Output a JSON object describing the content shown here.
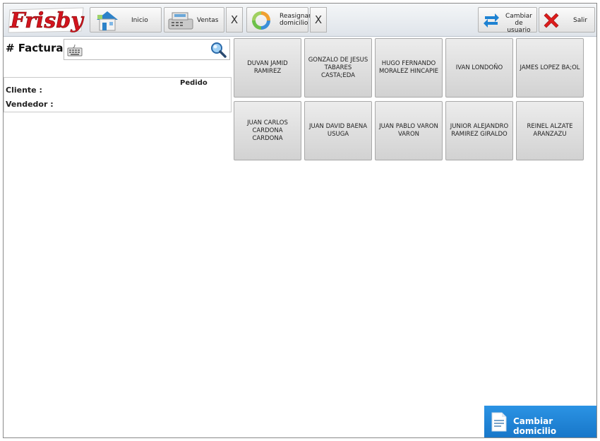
{
  "toolbar": {
    "logo_text": "Frisby",
    "inicio": "Inicio",
    "ventas": "Ventas",
    "close_x": "X",
    "reasignar_line1": "Reasignar",
    "reasignar_line2": "domicilio",
    "cambiar_usuario_line1": "Cambiar de",
    "cambiar_usuario_line2": "usuario",
    "salir": "Salir"
  },
  "factura": {
    "label": "# Factura",
    "value": ""
  },
  "info": {
    "pedido_label": "Pedido",
    "cliente_label": "Cliente :",
    "vendedor_label": "Vendedor :"
  },
  "vendors": [
    {
      "line1": "DUVAN JAMID",
      "line2": "RAMIREZ"
    },
    {
      "line1": "GONZALO DE JESUS",
      "line2": "TABARES CASTA;EDA"
    },
    {
      "line1": "HUGO FERNANDO",
      "line2": "MORALEZ HINCAPIE"
    },
    {
      "line1": "IVAN LONDOÑO",
      "line2": ""
    },
    {
      "line1": "JAMES  LOPEZ BA;OL",
      "line2": ""
    },
    {
      "line1": "JUAN CARLOS",
      "line2": "CARDONA CARDONA"
    },
    {
      "line1": "JUAN DAVID  BAENA",
      "line2": "USUGA"
    },
    {
      "line1": "JUAN PABLO VARON",
      "line2": "VARON"
    },
    {
      "line1": "JUNIOR ALEJANDRO",
      "line2": "RAMIREZ GIRALDO"
    },
    {
      "line1": "REINEL ALZATE",
      "line2": "ARANZAZU"
    }
  ],
  "footer": {
    "cambiar_domicilio": "Cambiar domicilio"
  },
  "colors": {
    "brand_red": "#d2141e",
    "accent_blue": "#1e82d2",
    "salir_red": "#dd1c1c"
  }
}
